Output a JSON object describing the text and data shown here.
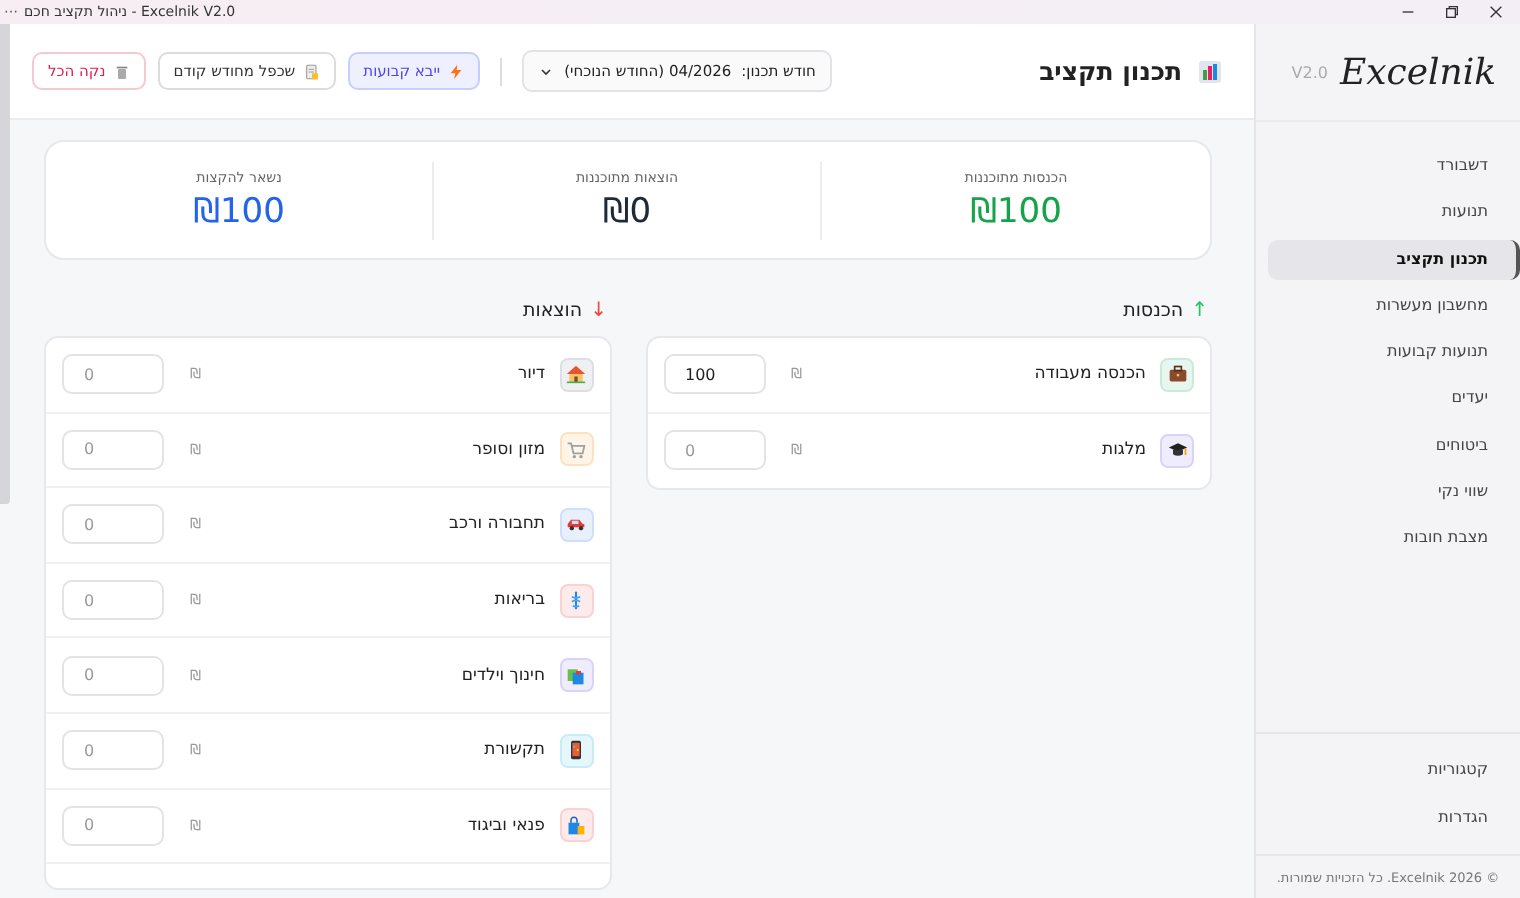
{
  "window": {
    "title": "ניהול תקציב חכם - Excelnik V2.0",
    "menu_glyph": "⋯"
  },
  "sidebar": {
    "logo": "Excelnik",
    "version": "V2.0",
    "items": [
      {
        "label": "דשבורד",
        "selected": false
      },
      {
        "label": "תנועות",
        "selected": false
      },
      {
        "label": "תכנון תקציב",
        "selected": true
      },
      {
        "label": "מחשבון מעשרות",
        "selected": false
      },
      {
        "label": "תנועות קבועות",
        "selected": false
      },
      {
        "label": "יעדים",
        "selected": false
      },
      {
        "label": "ביטוחים",
        "selected": false
      },
      {
        "label": "שווי נקי",
        "selected": false
      },
      {
        "label": "מצבת חובות",
        "selected": false
      }
    ],
    "bottom_items": [
      {
        "label": "קטגוריות",
        "selected": false
      },
      {
        "label": "הגדרות",
        "selected": false
      }
    ],
    "footer": "© Excelnik 2026. כל הזכויות שמורות."
  },
  "header": {
    "title": "תכנון תקציב",
    "month_label": "חודש תכנון:",
    "month_value": "04/2026 (החודש הנוכחי)",
    "buttons": [
      {
        "label": "ייבא קבועות",
        "kind": "primary"
      },
      {
        "label": "שכפל מחודש קודם",
        "kind": "default"
      },
      {
        "label": "נקה הכל",
        "kind": "danger"
      }
    ]
  },
  "summary": [
    {
      "label": "הכנסות מתוכננות",
      "value": "₪100",
      "color": "#16a34a"
    },
    {
      "label": "הוצאות מתוכננות",
      "value": "₪0",
      "color": "#1f2937"
    },
    {
      "label": "נשאר להקצות",
      "value": "₪100",
      "color": "#2563eb"
    }
  ],
  "income": {
    "title": "הכנסות",
    "arrow": "↑",
    "items": [
      {
        "label": "הכנסה מעבודה",
        "currency": "₪",
        "value": "100"
      },
      {
        "label": "מלגות",
        "currency": "₪",
        "placeholder": "0"
      }
    ]
  },
  "expenses": {
    "title": "הוצאות",
    "arrow": "↓",
    "items": [
      {
        "label": "דיור",
        "currency": "₪",
        "placeholder": "0"
      },
      {
        "label": "מזון וסופר",
        "currency": "₪",
        "placeholder": "0"
      },
      {
        "label": "תחבורה ורכב",
        "currency": "₪",
        "placeholder": "0"
      },
      {
        "label": "בריאות",
        "currency": "₪",
        "placeholder": "0"
      },
      {
        "label": "חינוך וילדים",
        "currency": "₪",
        "placeholder": "0"
      },
      {
        "label": "תקשורת",
        "currency": "₪",
        "placeholder": "0"
      },
      {
        "label": "פנאי וביגוד",
        "currency": "₪",
        "placeholder": "0"
      }
    ]
  }
}
